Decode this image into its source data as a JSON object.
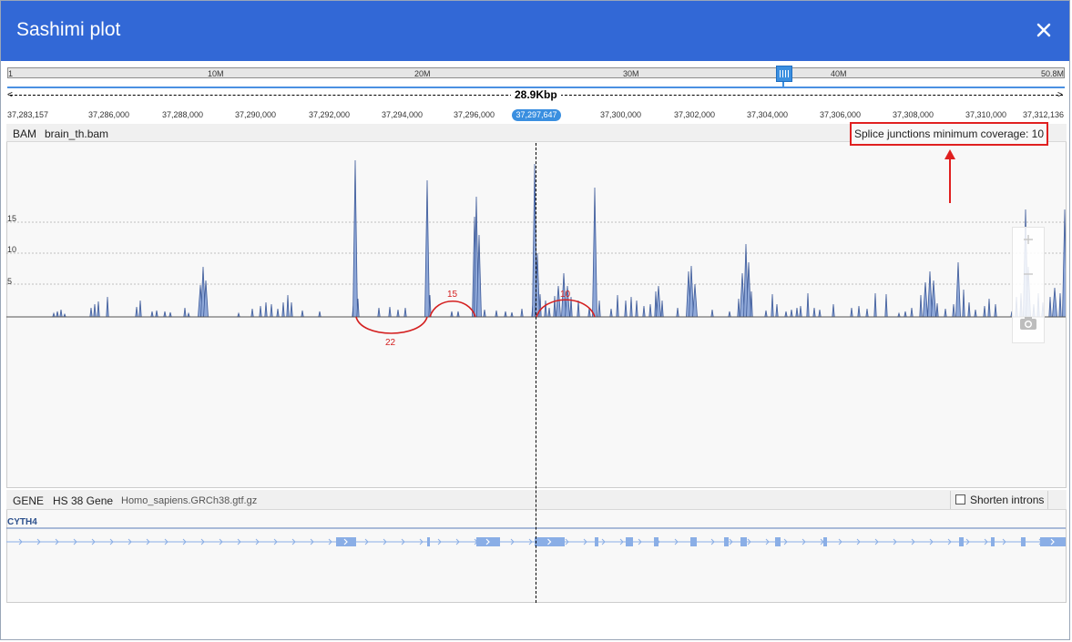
{
  "dialog": {
    "title": "Sashimi plot",
    "colors": {
      "header": "#3268d6",
      "coverage": "#8fa8d8",
      "coverage_outline": "#3d5a99",
      "junction": "#d42020",
      "gene": "#8aaee6"
    }
  },
  "ideogram": {
    "labels": [
      "1",
      "10M",
      "20M",
      "30M",
      "40M",
      "50.8M"
    ]
  },
  "ruler": {
    "span": "28.9Kbp",
    "ticks": [
      "37,283,157",
      "37,286,000",
      "37,288,000",
      "37,290,000",
      "37,292,000",
      "37,294,000",
      "37,296,000",
      "37,300,000",
      "37,302,000",
      "37,304,000",
      "37,306,000",
      "37,308,000",
      "37,310,000",
      "37,312,136"
    ],
    "current_position": "37,297,647"
  },
  "bam_track": {
    "type": "BAM",
    "name": "brain_th.bam",
    "min_coverage_label": "Splice junctions minimum coverage: 10",
    "y_ticks": [
      "15",
      "10",
      "5"
    ],
    "junction_labels": [
      "22",
      "15",
      "10"
    ]
  },
  "tools": {
    "zoom_in_icon": "plus-icon",
    "zoom_out_icon": "minus-icon",
    "screenshot_icon": "camera-icon"
  },
  "gene_track": {
    "type": "GENE",
    "name": "HS 38 Gene",
    "file": "Homo_sapiens.GRCh38.gtf.gz",
    "shorten_introns_label": "Shorten introns",
    "shorten_introns_checked": false,
    "gene_symbol": "CYTH4"
  }
}
